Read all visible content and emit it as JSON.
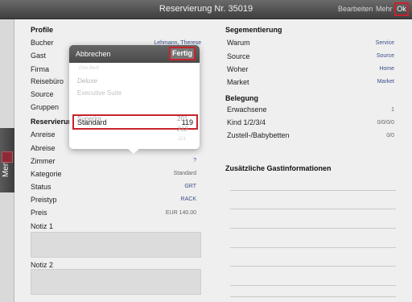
{
  "topbar": {
    "title": "Reservierung Nr. 35019",
    "edit": "Bearbeiten",
    "more": "Mehr",
    "ok": "Ok"
  },
  "sidebar": {
    "menu": "Menü"
  },
  "profile": {
    "title": "Profile",
    "rows": [
      {
        "label": "Bucher",
        "value": "Lehmann, Therese"
      },
      {
        "label": "Gast",
        "value": ""
      },
      {
        "label": "Firma",
        "value": ""
      },
      {
        "label": "Reisebüro",
        "value": ""
      },
      {
        "label": "Source",
        "value": ""
      },
      {
        "label": "Gruppen",
        "value": ""
      }
    ]
  },
  "reservation": {
    "title": "Reservierung",
    "rows": [
      {
        "label": "Anreise",
        "value": ""
      },
      {
        "label": "Abreise",
        "value": ""
      },
      {
        "label": "Zimmer",
        "value": "?"
      },
      {
        "label": "Kategorie",
        "value": "Standard"
      },
      {
        "label": "Status",
        "value": "GRT"
      },
      {
        "label": "Preistyp",
        "value": "RACK"
      },
      {
        "label": "Preis",
        "value": "EUR 140.00"
      }
    ]
  },
  "notes": {
    "note1": "Notiz 1",
    "note2": "Notiz 2"
  },
  "segmentation": {
    "title": "Segementierung",
    "rows": [
      {
        "label": "Warum",
        "value": "Service"
      },
      {
        "label": "Source",
        "value": "Source"
      },
      {
        "label": "Woher",
        "value": "Home"
      },
      {
        "label": "Market",
        "value": "Market"
      }
    ]
  },
  "occupancy": {
    "title": "Belegung",
    "rows": [
      {
        "label": "Erwachsene",
        "value": "1"
      },
      {
        "label": "Kind 1/2/3/4",
        "value": "0/0/0/0"
      },
      {
        "label": "Zustell-/Babybetten",
        "value": "0/0"
      }
    ]
  },
  "extra_info": {
    "title": "Zusätzliche Gastinformationen"
  },
  "picker": {
    "cancel": "Abbrechen",
    "done": "Fertig",
    "options": [
      {
        "name": "One Bedr",
        "num": ""
      },
      {
        "name": "Deluxe",
        "num": ""
      },
      {
        "name": "Executive Suite",
        "num": ""
      },
      {
        "name": "Standard",
        "num": "119"
      },
      {
        "name": "Superior",
        "num": "201"
      }
    ],
    "numbers_below": [
      "212",
      "221"
    ],
    "selected_index": 3
  },
  "colors": {
    "accent_red": "#c8232c",
    "value_blue": "#3a4f8a"
  }
}
